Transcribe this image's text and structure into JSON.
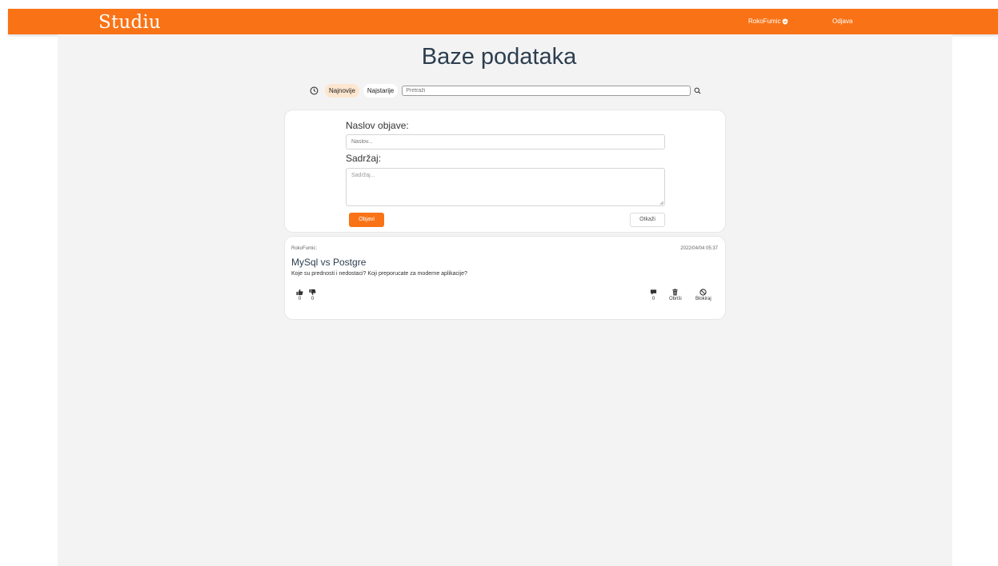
{
  "header": {
    "logo": "Studiu",
    "username": "RokoFumic",
    "logout_label": "Odjava"
  },
  "page": {
    "title": "Baze podataka"
  },
  "filters": {
    "newest_label": "Najnovije",
    "oldest_label": "Najstarije",
    "search_placeholder": "Pretraži"
  },
  "new_post_form": {
    "title_label": "Naslov objave:",
    "title_placeholder": "Naslov...",
    "content_label": "Sadržaj:",
    "content_placeholder": "Sadržaj...",
    "submit_label": "Objavi",
    "cancel_label": "Otkaži"
  },
  "post": {
    "author": "RokoFumic:",
    "date": "2022/04/04 05:37",
    "title": "MySql vs Postgre",
    "body": "Koje su prednosti i nedostaci? Koji preporucate za moderne aplikacije?",
    "likes": "0",
    "dislikes": "0",
    "comments": "0",
    "delete_label": "Obriši",
    "block_label": "Blokiraj"
  },
  "colors": {
    "accent": "#f97316",
    "active_chip": "#fde6cf",
    "background": "#f3f3f3"
  }
}
